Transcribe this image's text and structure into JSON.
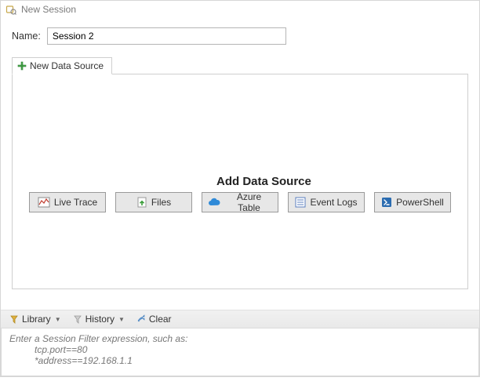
{
  "window": {
    "title": "New Session"
  },
  "name_field": {
    "label": "Name:",
    "value": "Session 2"
  },
  "tab": {
    "label": "New Data Source"
  },
  "add_data_source": {
    "heading": "Add Data Source",
    "buttons": {
      "live_trace": "Live Trace",
      "files": "Files",
      "azure_table": "Azure Table",
      "event_logs": "Event Logs",
      "powershell": "PowerShell"
    }
  },
  "toolbar": {
    "library": "Library",
    "history": "History",
    "clear": "Clear"
  },
  "filter": {
    "placeholder_line1": "Enter a Session Filter expression, such as:",
    "placeholder_line2": "tcp.port==80",
    "placeholder_line3": "*address==192.168.1.1"
  }
}
